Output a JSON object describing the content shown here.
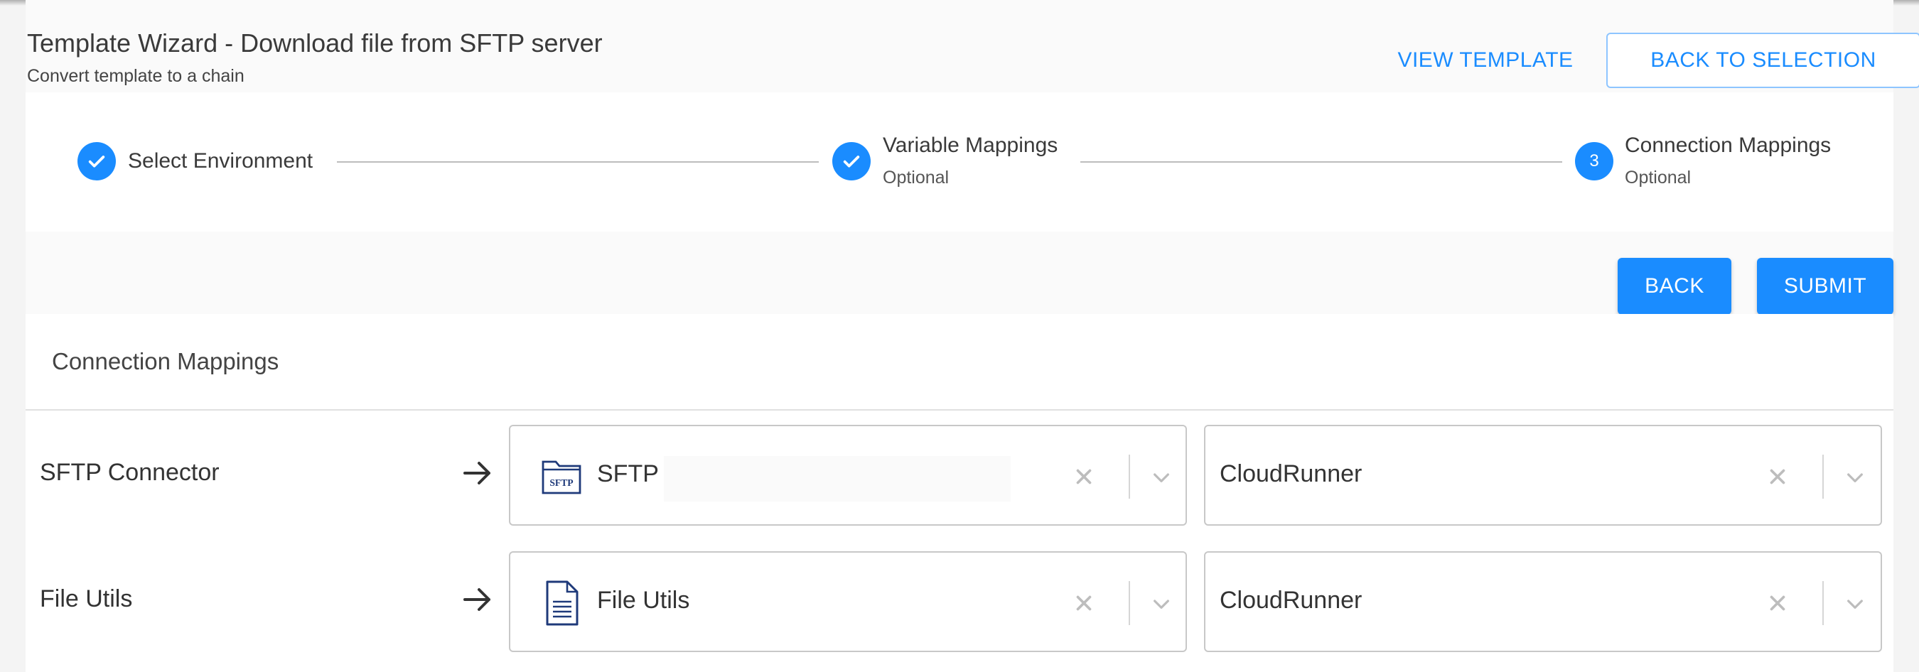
{
  "header": {
    "title": "Template Wizard - Download file from SFTP server",
    "subtitle": "Convert template to a chain",
    "view_template_label": "VIEW TEMPLATE",
    "back_to_selection_label": "BACK TO SELECTION"
  },
  "stepper": {
    "steps": [
      {
        "label": "Select Environment",
        "sub": "",
        "state": "completed"
      },
      {
        "label": "Variable Mappings",
        "sub": "Optional",
        "state": "completed"
      },
      {
        "label": "Connection Mappings",
        "sub": "Optional",
        "state": "active",
        "number": "3"
      }
    ]
  },
  "actions": {
    "back_label": "BACK",
    "submit_label": "SUBMIT"
  },
  "panel": {
    "title": "Connection Mappings",
    "rows": [
      {
        "label": "SFTP Connector",
        "connection": "SFTP",
        "connection_icon": "sftp-folder-icon",
        "icon_text": "SFTP",
        "runner": "CloudRunner"
      },
      {
        "label": "File Utils",
        "connection": "File Utils",
        "connection_icon": "document-icon",
        "runner": "CloudRunner"
      }
    ]
  },
  "colors": {
    "accent": "#1a8cff",
    "icon_navy": "#1f3a7a"
  }
}
